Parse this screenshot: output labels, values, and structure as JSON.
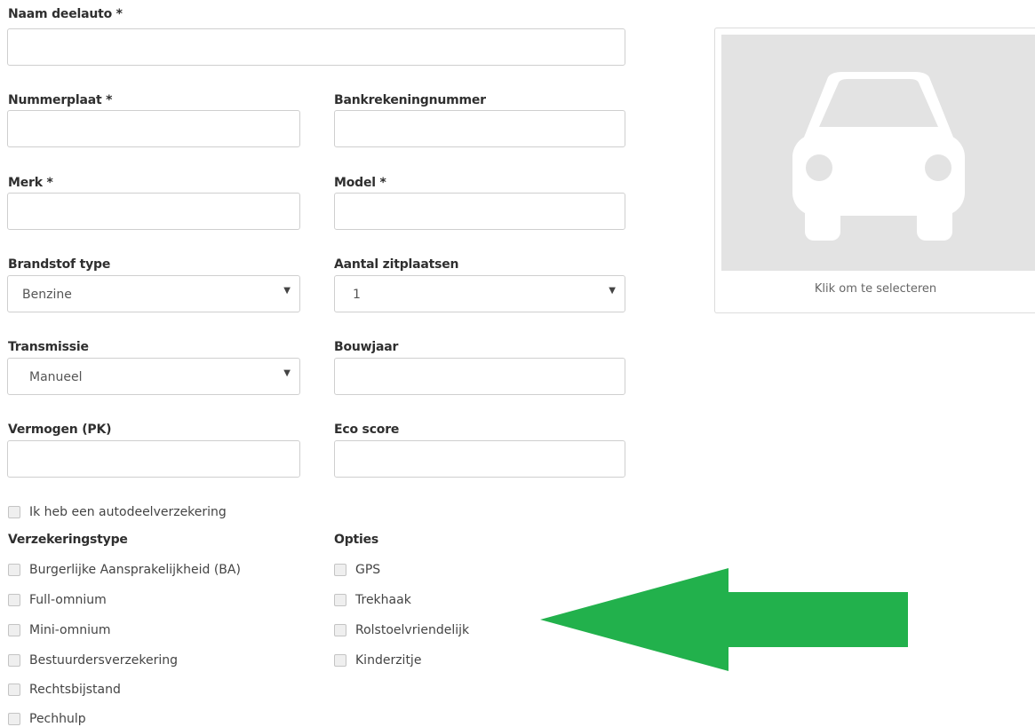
{
  "form": {
    "name_label": "Naam deelauto *",
    "plate_label": "Nummerplaat *",
    "bank_label": "Bankrekeningnummer",
    "brand_label": "Merk *",
    "model_label": "Model *",
    "fuel_label": "Brandstof type",
    "fuel_value": "Benzine",
    "seats_label": "Aantal zitplaatsen",
    "seats_value": "1",
    "transmission_label": "Transmissie",
    "transmission_value": "Manueel",
    "year_label": "Bouwjaar",
    "power_label": "Vermogen (PK)",
    "eco_label": "Eco score",
    "select_caret": "▼"
  },
  "photo": {
    "caption": "Klik om te selecteren",
    "icon": "car-icon"
  },
  "insurance": {
    "own_insurance_label": "Ik heb een autodeelverzekering",
    "type_heading": "Verzekeringstype",
    "types": [
      "Burgerlijke Aansprakelijkheid (BA)",
      "Full-omnium",
      "Mini-omnium",
      "Bestuurdersverzekering",
      "Rechtsbijstand",
      "Pechhulp"
    ]
  },
  "options": {
    "heading": "Opties",
    "items": [
      "GPS",
      "Trekhaak",
      "Rolstoelvriendelijk",
      "Kinderzitje"
    ]
  },
  "annotation": {
    "arrow_color": "#22b14c",
    "icon": "arrow-left-icon"
  }
}
